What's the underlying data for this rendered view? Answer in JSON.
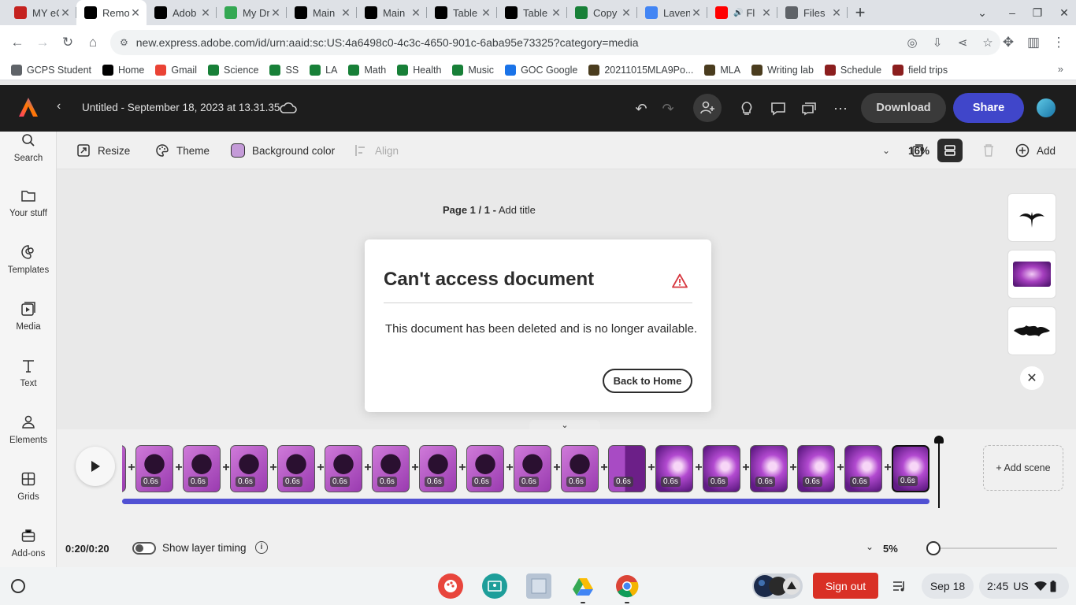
{
  "browser": {
    "tabs": [
      {
        "title": "MY eC",
        "favicon": "ec-icon",
        "color": "#c5221f"
      },
      {
        "title": "Remo",
        "favicon": "adobe-express-icon",
        "color": "#000000",
        "active": true
      },
      {
        "title": "Adob",
        "favicon": "adobe-express-icon",
        "color": "#000000"
      },
      {
        "title": "My Dr",
        "favicon": "google-drive-icon",
        "color": "#34a853"
      },
      {
        "title": "Main",
        "favicon": "d2l-icon",
        "color": "#000000"
      },
      {
        "title": "Main",
        "favicon": "d2l-icon",
        "color": "#000000"
      },
      {
        "title": "Table",
        "favicon": "d2l-icon",
        "color": "#000000"
      },
      {
        "title": "Table",
        "favicon": "d2l-icon",
        "color": "#000000"
      },
      {
        "title": "Copy",
        "favicon": "google-sheets-icon",
        "color": "#188038"
      },
      {
        "title": "Laven",
        "favicon": "google-icon",
        "color": "#4285f4"
      },
      {
        "title": "Fl",
        "favicon": "youtube-icon",
        "color": "#ff0000",
        "audio": true
      },
      {
        "title": "Files",
        "favicon": "files-icon",
        "color": "#5f6368"
      }
    ],
    "url": "new.express.adobe.com/id/urn:aaid:sc:US:4a6498c0-4c3c-4650-901c-6aba95e73325?category=media",
    "bookmarks": [
      {
        "label": "GCPS Student",
        "icon": "folder-icon",
        "color": "#5f6368"
      },
      {
        "label": "Home",
        "icon": "d2l-icon",
        "color": "#000000"
      },
      {
        "label": "Gmail",
        "icon": "gmail-icon",
        "color": "#ea4335"
      },
      {
        "label": "Science",
        "icon": "google-sheets-icon",
        "color": "#188038"
      },
      {
        "label": "SS",
        "icon": "google-sheets-icon",
        "color": "#188038"
      },
      {
        "label": "LA",
        "icon": "google-sheets-icon",
        "color": "#188038"
      },
      {
        "label": "Math",
        "icon": "google-sheets-icon",
        "color": "#188038"
      },
      {
        "label": "Health",
        "icon": "google-sheets-icon",
        "color": "#188038"
      },
      {
        "label": "Music",
        "icon": "google-sheets-icon",
        "color": "#188038"
      },
      {
        "label": "GOC Google",
        "icon": "goc-icon",
        "color": "#1a73e8"
      },
      {
        "label": "20211015MLA9Po...",
        "icon": "purdue-owl-icon",
        "color": "#4a3c1e"
      },
      {
        "label": "MLA",
        "icon": "purdue-owl-icon",
        "color": "#4a3c1e"
      },
      {
        "label": "Writing lab",
        "icon": "purdue-owl-icon",
        "color": "#4a3c1e"
      },
      {
        "label": "Schedule",
        "icon": "calendar-icon",
        "color": "#8b1e1e"
      },
      {
        "label": "field trips",
        "icon": "calendar-icon",
        "color": "#8b1e1e"
      }
    ]
  },
  "app": {
    "document_title": "Untitled - September 18, 2023 at 13.31.35",
    "download_label": "Download",
    "share_label": "Share",
    "brand_color": "#4046ca"
  },
  "rail": [
    {
      "label": "Search",
      "icon": "search-icon"
    },
    {
      "label": "Your stuff",
      "icon": "folder-icon"
    },
    {
      "label": "Templates",
      "icon": "templates-icon"
    },
    {
      "label": "Media",
      "icon": "media-icon"
    },
    {
      "label": "Text",
      "icon": "text-icon"
    },
    {
      "label": "Elements",
      "icon": "elements-icon"
    },
    {
      "label": "Grids",
      "icon": "grids-icon"
    },
    {
      "label": "Add-ons",
      "icon": "addons-icon"
    }
  ],
  "subbar": {
    "resize": "Resize",
    "theme": "Theme",
    "background_color": "Background color",
    "background_swatch": "#c49bd8",
    "align": "Align",
    "zoom": "16%",
    "add": "Add"
  },
  "canvas": {
    "page_prefix": "Page 1 / 1 -",
    "add_title": "Add title"
  },
  "modal": {
    "title": "Can't access document",
    "message": "This document has been deleted and is no longer available.",
    "button": "Back to Home",
    "warning_color": "#d7373f"
  },
  "timeline": {
    "scene_duration": "0.6s",
    "scene_count": 18,
    "add_scene": "+ Add scene",
    "time": "0:20/0:20",
    "layer_timing": "Show layer timing",
    "zoom": "5%"
  },
  "shelf": {
    "sign_out": "Sign out",
    "date": "Sep 18",
    "time": "2:45",
    "region": "US"
  }
}
